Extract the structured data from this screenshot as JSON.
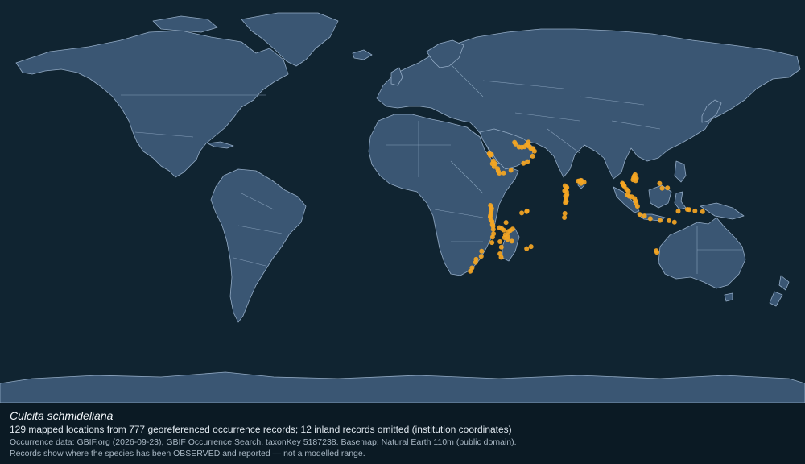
{
  "map": {
    "projection": "equirectangular",
    "point_color": "#f5a623",
    "land_color": "#3a5673",
    "ocean_color": "#102431",
    "occurrence_points": [
      {
        "lon": 40.2,
        "lat": 16.8
      },
      {
        "lon": 41.0,
        "lat": 15.6
      },
      {
        "lon": 39.2,
        "lat": 20.6
      },
      {
        "lon": 38.8,
        "lat": 21.4
      },
      {
        "lon": 40.6,
        "lat": 18.1
      },
      {
        "lon": 42.8,
        "lat": 13.5
      },
      {
        "lon": 43.3,
        "lat": 12.6
      },
      {
        "lon": 45.2,
        "lat": 12.7
      },
      {
        "lon": 48.5,
        "lat": 13.9
      },
      {
        "lon": 50.6,
        "lat": 25.6
      },
      {
        "lon": 50.1,
        "lat": 26.4
      },
      {
        "lon": 52.1,
        "lat": 24.3
      },
      {
        "lon": 54.6,
        "lat": 24.4
      },
      {
        "lon": 55.6,
        "lat": 25.4
      },
      {
        "lon": 56.3,
        "lat": 26.5
      },
      {
        "lon": 56.6,
        "lat": 24.6
      },
      {
        "lon": 58.4,
        "lat": 23.6
      },
      {
        "lon": 59.0,
        "lat": 22.4
      },
      {
        "lon": 58.2,
        "lat": 20.2
      },
      {
        "lon": 54.1,
        "lat": 17.0
      },
      {
        "lon": 55.9,
        "lat": 17.8
      },
      {
        "lon": 72.7,
        "lat": 7.0
      },
      {
        "lon": 73.1,
        "lat": 5.6
      },
      {
        "lon": 73.4,
        "lat": 4.2
      },
      {
        "lon": 73.5,
        "lat": 3.0
      },
      {
        "lon": 73.2,
        "lat": 1.8
      },
      {
        "lon": 73.0,
        "lat": 0.5
      },
      {
        "lon": 72.9,
        "lat": 2.4
      },
      {
        "lon": 73.5,
        "lat": 6.2
      },
      {
        "lon": 72.4,
        "lat": -7.2
      },
      {
        "lon": 72.6,
        "lat": -5.4
      },
      {
        "lon": 79.9,
        "lat": 9.4
      },
      {
        "lon": 78.6,
        "lat": 9.1
      },
      {
        "lon": 79.3,
        "lat": 9.2
      },
      {
        "lon": 81.2,
        "lat": 8.6
      },
      {
        "lon": 39.7,
        "lat": -4.0
      },
      {
        "lon": 39.5,
        "lat": -5.2
      },
      {
        "lon": 39.3,
        "lat": -6.3
      },
      {
        "lon": 39.5,
        "lat": -8.2
      },
      {
        "lon": 40.2,
        "lat": -10.3
      },
      {
        "lon": 39.2,
        "lat": -7.0
      },
      {
        "lon": 40.6,
        "lat": -12.5
      },
      {
        "lon": 40.7,
        "lat": -14.5
      },
      {
        "lon": 40.3,
        "lat": -16.0
      },
      {
        "lon": 43.3,
        "lat": -11.7
      },
      {
        "lon": 44.4,
        "lat": -12.2
      },
      {
        "lon": 45.2,
        "lat": -12.8
      },
      {
        "lon": 46.3,
        "lat": -9.4
      },
      {
        "lon": 47.4,
        "lat": -13.4
      },
      {
        "lon": 48.2,
        "lat": -13.0
      },
      {
        "lon": 49.3,
        "lat": -12.3
      },
      {
        "lon": 47.1,
        "lat": -15.7
      },
      {
        "lon": 44.2,
        "lat": -20.4
      },
      {
        "lon": 43.6,
        "lat": -23.4
      },
      {
        "lon": 44.1,
        "lat": -25.0
      },
      {
        "lon": 55.5,
        "lat": -4.6
      },
      {
        "lon": 53.3,
        "lat": -5.2
      },
      {
        "lon": 57.5,
        "lat": -20.2
      },
      {
        "lon": 55.5,
        "lat": -21.1
      },
      {
        "lon": 35.4,
        "lat": -22.2
      },
      {
        "lon": 35.2,
        "lat": -24.5
      },
      {
        "lon": 32.9,
        "lat": -25.9
      },
      {
        "lon": 32.7,
        "lat": -27.2
      },
      {
        "lon": 31.1,
        "lat": -29.7
      },
      {
        "lon": 30.3,
        "lat": -31.2
      },
      {
        "lon": 98.3,
        "lat": 8.1
      },
      {
        "lon": 98.6,
        "lat": 7.6
      },
      {
        "lon": 99.2,
        "lat": 6.8
      },
      {
        "lon": 100.2,
        "lat": 5.4
      },
      {
        "lon": 103.9,
        "lat": 10.1
      },
      {
        "lon": 103.6,
        "lat": 11.3
      },
      {
        "lon": 104.3,
        "lat": 9.2
      },
      {
        "lon": 103.4,
        "lat": 10.6
      },
      {
        "lon": 104.6,
        "lat": 10.3
      },
      {
        "lon": 100.5,
        "lat": 3.0
      },
      {
        "lon": 101.4,
        "lat": 2.3
      },
      {
        "lon": 103.8,
        "lat": 1.3
      },
      {
        "lon": 104.2,
        "lat": 0.2
      },
      {
        "lon": 105.1,
        "lat": -2.2
      },
      {
        "lon": 106.1,
        "lat": -5.8
      },
      {
        "lon": 108.2,
        "lat": -6.5
      },
      {
        "lon": 110.8,
        "lat": -7.7
      },
      {
        "lon": 115.2,
        "lat": -8.5
      },
      {
        "lon": 119.2,
        "lat": -8.6
      },
      {
        "lon": 121.6,
        "lat": -9.3
      },
      {
        "lon": 123.3,
        "lat": -4.4
      },
      {
        "lon": 127.4,
        "lat": -3.6
      },
      {
        "lon": 128.2,
        "lat": -3.7
      },
      {
        "lon": 130.8,
        "lat": -4.3
      },
      {
        "lon": 134.2,
        "lat": -4.6
      },
      {
        "lon": 113.5,
        "lat": -22.0
      },
      {
        "lon": 113.8,
        "lat": -22.8
      },
      {
        "lon": 115.0,
        "lat": 8.0
      },
      {
        "lon": 116.1,
        "lat": 5.9
      },
      {
        "lon": 118.5,
        "lat": 6.0
      },
      {
        "lon": 40.0,
        "lat": -18.4
      },
      {
        "lon": 40.5,
        "lat": -11.0
      },
      {
        "lon": 43.6,
        "lat": -18.0
      },
      {
        "lon": 45.6,
        "lat": -16.2
      },
      {
        "lon": 48.9,
        "lat": -17.8
      },
      {
        "lon": 47.0,
        "lat": -17.0
      },
      {
        "lon": 46.0,
        "lat": -14.9
      },
      {
        "lon": 72.5,
        "lat": 4.8
      },
      {
        "lon": 73.3,
        "lat": 0.0
      },
      {
        "lon": 72.8,
        "lat": -0.6
      },
      {
        "lon": 98.9,
        "lat": 7.2
      },
      {
        "lon": 101.0,
        "lat": 4.5
      },
      {
        "lon": 102.5,
        "lat": 2.1
      },
      {
        "lon": 104.5,
        "lat": -1.0
      },
      {
        "lon": 103.1,
        "lat": 9.6
      },
      {
        "lon": 104.0,
        "lat": 11.9
      },
      {
        "lon": 57.4,
        "lat": 23.7
      },
      {
        "lon": 53.4,
        "lat": 24.2
      },
      {
        "lon": 56.1,
        "lat": 25.1
      },
      {
        "lon": 39.8,
        "lat": 21.0
      },
      {
        "lon": 41.5,
        "lat": 16.9
      },
      {
        "lon": 42.5,
        "lat": 14.7
      },
      {
        "lon": 39.3,
        "lat": -1.8
      },
      {
        "lon": 39.9,
        "lat": -3.2
      },
      {
        "lon": 39.6,
        "lat": -2.4
      },
      {
        "lon": 40.1,
        "lat": -9.0
      },
      {
        "lon": 55.7,
        "lat": -4.3
      },
      {
        "lon": 79.8,
        "lat": 8.0
      }
    ]
  },
  "caption": {
    "species": "Culcita schmideliana",
    "summary": "129 mapped locations from 777 georeferenced occurrence records; 12 inland records omitted (institution coordinates)",
    "source": "Occurrence data: GBIF.org (2026-09-23), GBIF Occurrence Search, taxonKey 5187238. Basemap: Natural Earth 110m (public domain).",
    "disclaimer": "Records show where the species has been OBSERVED and reported — not a modelled range."
  }
}
